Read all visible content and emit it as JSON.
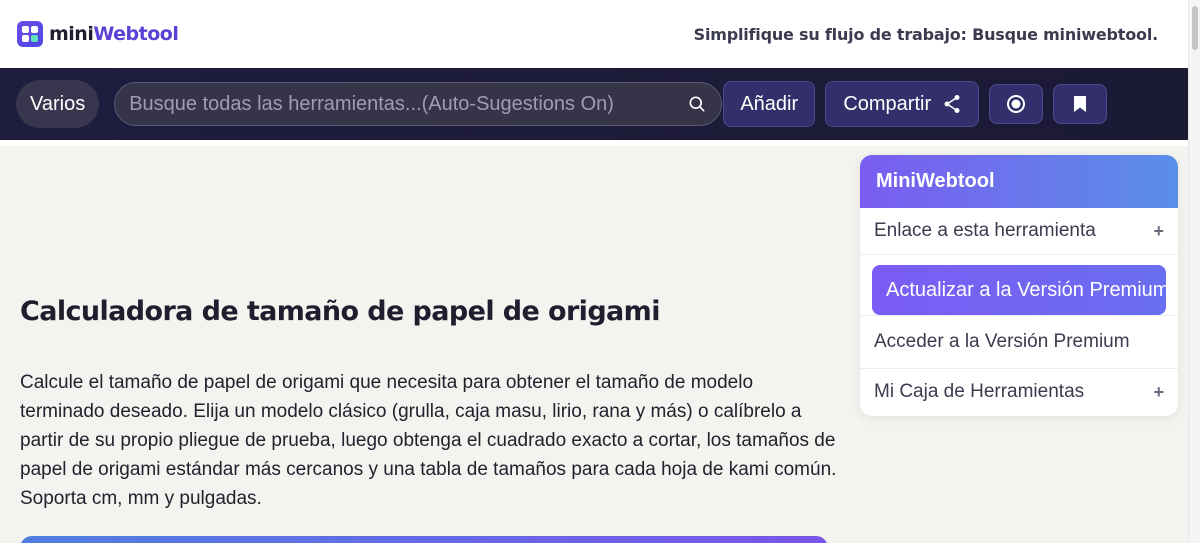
{
  "header": {
    "logo_mini": "mini",
    "logo_web": "Webtool",
    "tagline": "Simplifique su flujo de trabajo: Busque miniwebtool."
  },
  "navbar": {
    "varios_label": "Varios",
    "search_placeholder": "Busque todas las herramientas...(Auto-Sugestions On)",
    "add_label": "Añadir",
    "share_label": "Compartir"
  },
  "main": {
    "title": "Calculadora de tamaño de papel de origami",
    "description": "Calcule el tamaño de papel de origami que necesita para obtener el tamaño de modelo terminado deseado. Elija un modelo clásico (grulla, caja masu, lirio, rana y más) o calíbrelo a partir de su propio pliegue de prueba, luego obtenga el cuadrado exacto a cortar, los tamaños de papel de origami estándar más cercanos y una tabla de tamaños para cada hoja de kami común. Soporta cm, mm y pulgadas."
  },
  "sidebar": {
    "title": "MiniWebtool",
    "link_label": "Enlace a esta herramienta",
    "premium_upgrade_label": "Actualizar a la Versión Premium",
    "premium_access_label": "Acceder a la Versión Premium",
    "toolbox_label": "Mi Caja de Herramientas",
    "plus_symbol": "+"
  },
  "colors": {
    "brand_purple": "#5b3fd6",
    "nav_bg": "#1f1d3e",
    "premium_gradient_start": "#7b5cf5",
    "page_bg": "#f3f3ef"
  }
}
